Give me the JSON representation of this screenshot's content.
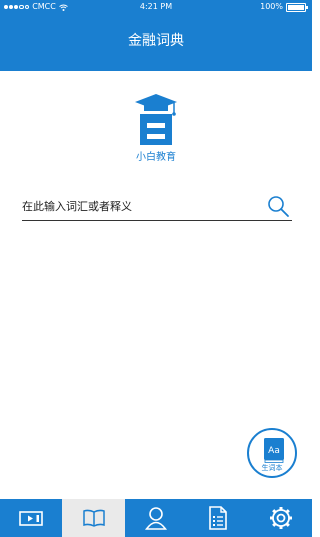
{
  "status_bar": {
    "carrier": "CMCC",
    "time": "4:21 PM",
    "battery": "100%"
  },
  "header": {
    "title": "金融词典"
  },
  "brand": {
    "name": "小白教育"
  },
  "search": {
    "placeholder": "在此输入词汇或者释义",
    "value": ""
  },
  "fab": {
    "label": "生词本",
    "book_text": "Aa"
  },
  "tabbar": {
    "items": [
      {
        "icon": "video-icon",
        "active": false
      },
      {
        "icon": "book-open-icon",
        "active": true
      },
      {
        "icon": "user-icon",
        "active": false
      },
      {
        "icon": "document-icon",
        "active": false
      },
      {
        "icon": "gear-icon",
        "active": false
      }
    ]
  },
  "colors": {
    "primary": "#1a7fd0",
    "tab_active_bg": "#eaeaea"
  }
}
